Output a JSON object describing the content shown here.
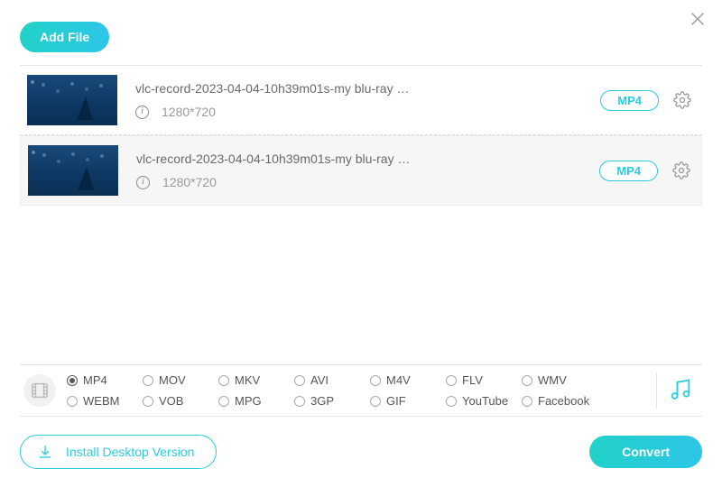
{
  "header": {
    "add_file_label": "Add File"
  },
  "files": [
    {
      "name": "vlc-record-2023-04-04-10h39m01s-my blu-ray …",
      "resolution": "1280*720",
      "format": "MP4"
    },
    {
      "name": "vlc-record-2023-04-04-10h39m01s-my blu-ray …",
      "resolution": "1280*720",
      "format": "MP4"
    }
  ],
  "formats": {
    "row1": [
      "MP4",
      "MOV",
      "MKV",
      "AVI",
      "M4V",
      "FLV",
      "WMV"
    ],
    "row2": [
      "WEBM",
      "VOB",
      "MPG",
      "3GP",
      "GIF",
      "YouTube",
      "Facebook"
    ],
    "selected": "MP4"
  },
  "footer": {
    "install_label": "Install Desktop Version",
    "convert_label": "Convert"
  }
}
